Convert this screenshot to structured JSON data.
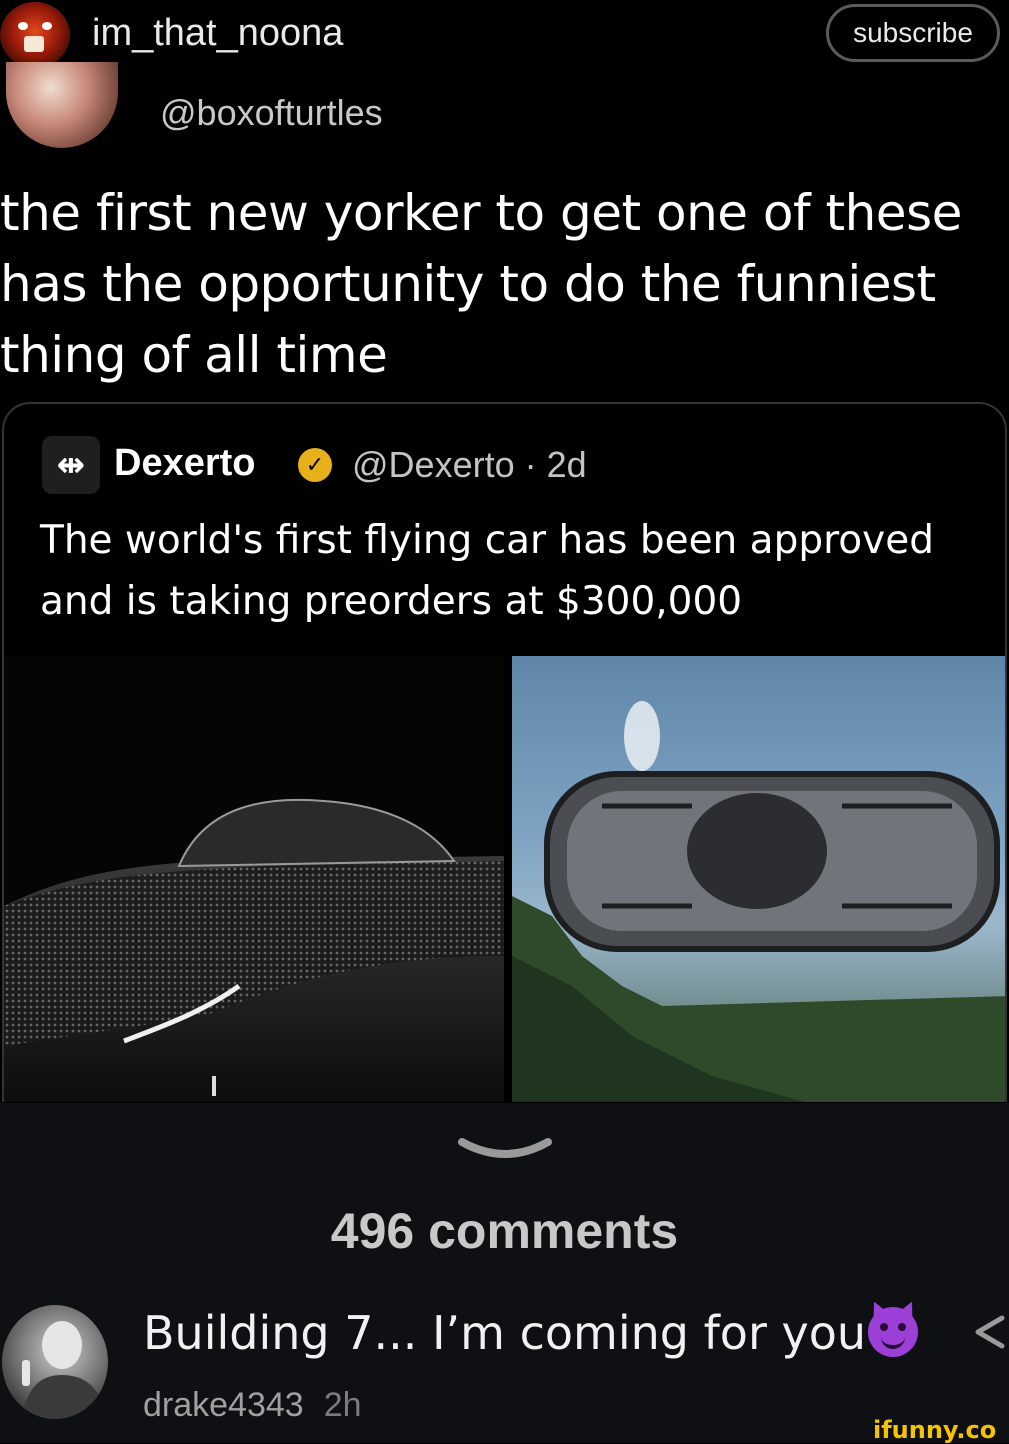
{
  "header": {
    "username": "im_that_noona",
    "subscribe_label": "subscribe"
  },
  "tweet": {
    "handle": "@boxofturtles",
    "text": "the first new yorker to get one of these has the opportunity to do the funniest thing of all time"
  },
  "quoted_tweet": {
    "logo_glyph": "⇹",
    "name": "Dexerto",
    "handle_time": "@Dexerto · 2d",
    "text": "The world's first flying car has been approved and is taking preorders at $300,000"
  },
  "comments": {
    "count_label": "496 comments"
  },
  "top_comment": {
    "text": "Building 7... I’m coming for you",
    "author": "drake4343",
    "time": "2h"
  },
  "watermark": "ifunny.co",
  "colors": {
    "accent_badge": "#e8b11c",
    "watermark": "#f4c400",
    "lower_bg": "#0f1013"
  }
}
